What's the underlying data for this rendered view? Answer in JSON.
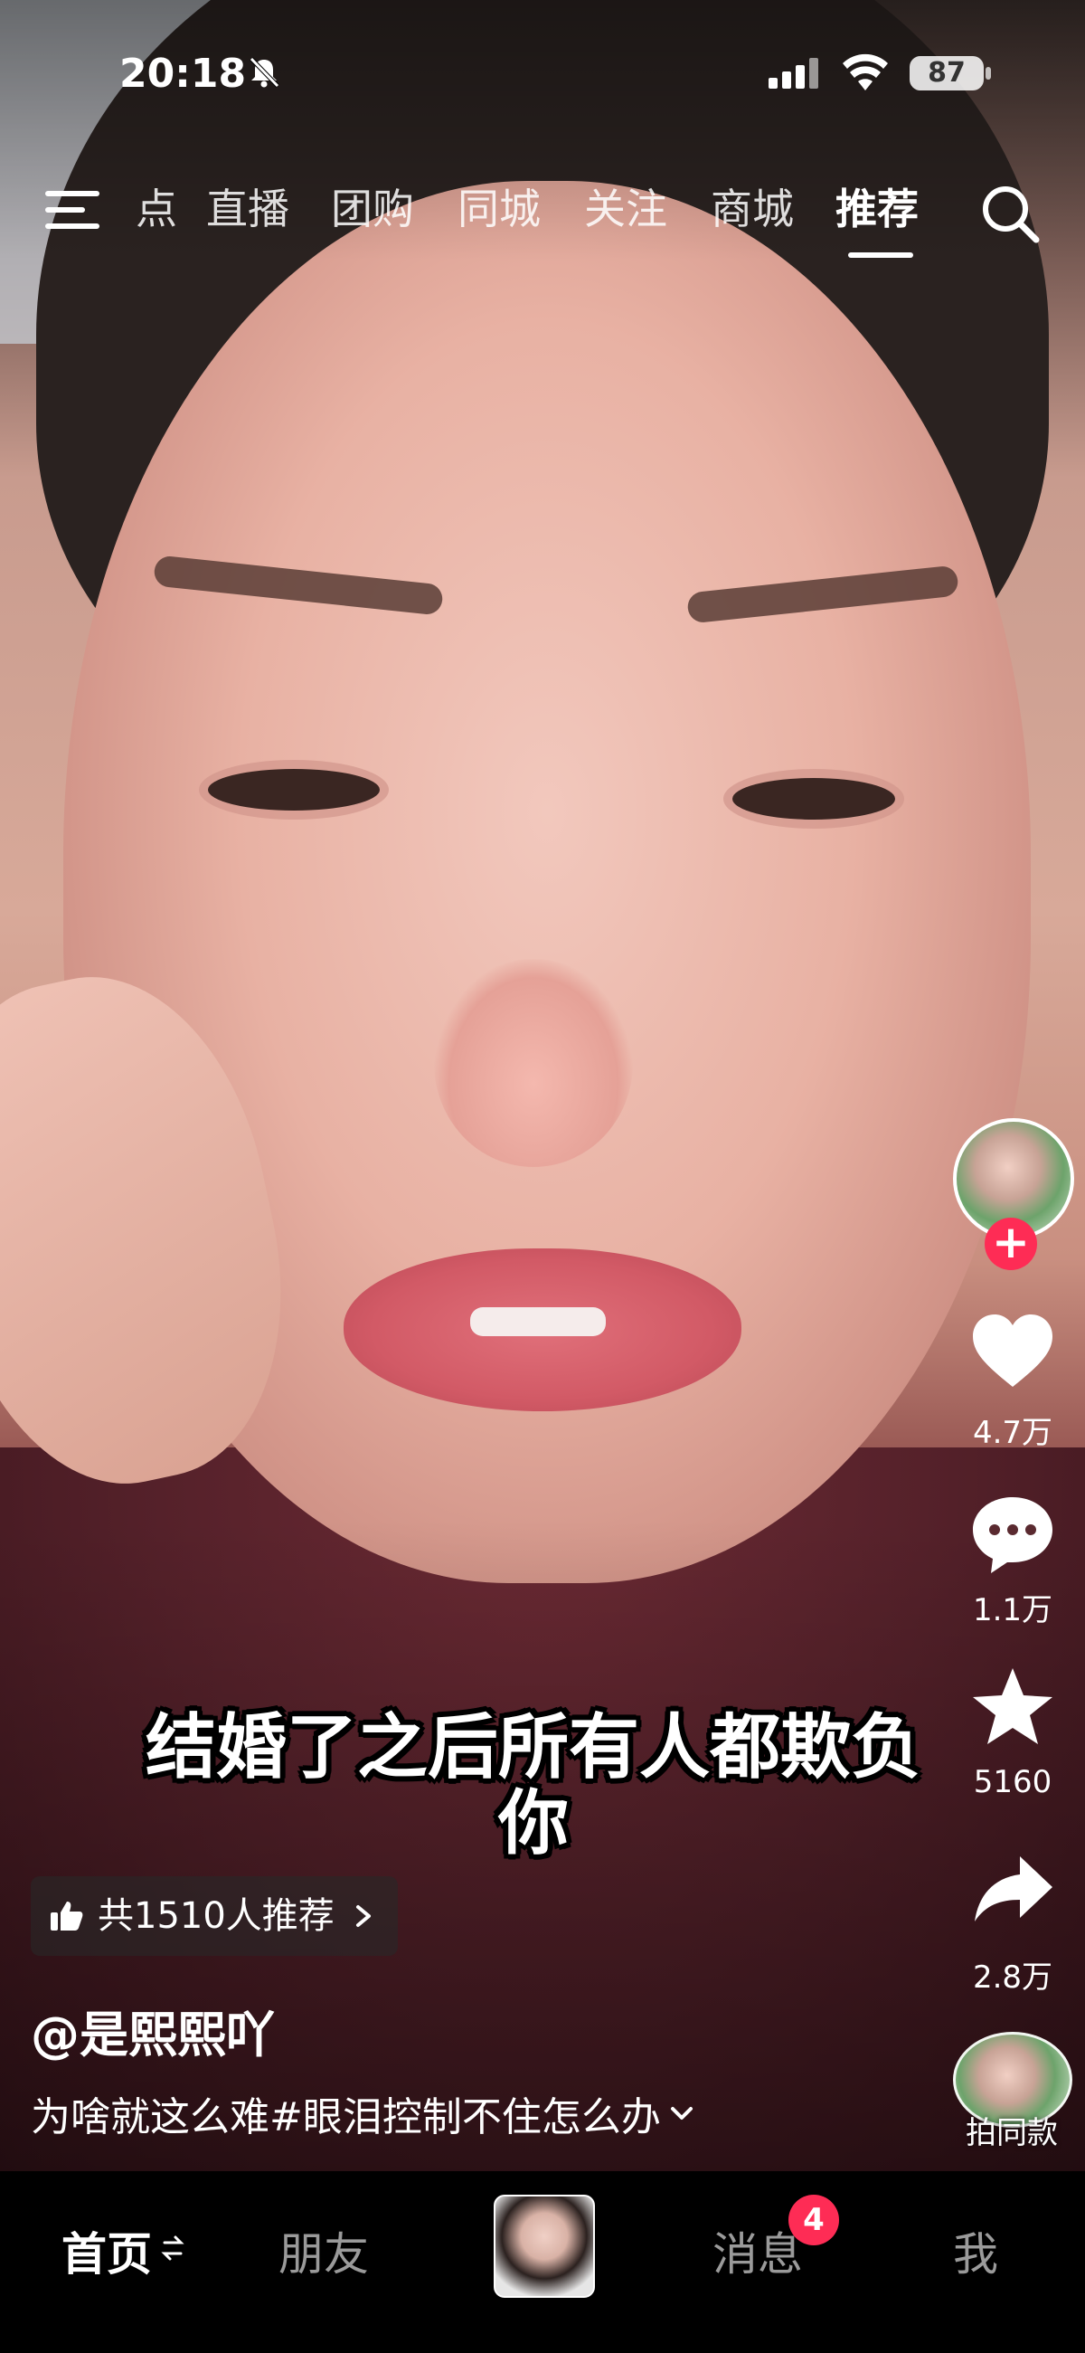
{
  "status_bar": {
    "time": "20:18",
    "battery": "87"
  },
  "top_tabs": [
    "点",
    "直播",
    "团购",
    "同城",
    "关注",
    "商城",
    "推荐"
  ],
  "active_tab": "推荐",
  "video": {
    "subtitle_line1": "结婚了之后所有人都欺负",
    "subtitle_line2": "你"
  },
  "actions": {
    "likes": "4.7万",
    "comments": "1.1万",
    "favorites": "5160",
    "shares": "2.8万",
    "remix_label": "拍同款"
  },
  "recommend_chip": "共1510人推荐",
  "author": "@是熙熙吖",
  "caption": "为啥就这么难#眼泪控制不住怎么办",
  "bottom_nav": {
    "home": "首页",
    "friends": "朋友",
    "messages": "消息",
    "messages_badge": "4",
    "me": "我"
  },
  "colors": {
    "accent": "#fe2c55",
    "bottom_bg": "#000000"
  }
}
